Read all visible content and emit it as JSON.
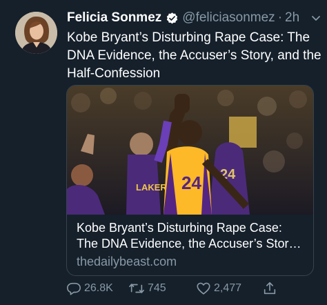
{
  "tweet": {
    "author_name": "Felicia Sonmez",
    "handle": "@feliciasonmez",
    "separator": "·",
    "time": "2h",
    "text": "Kobe Bryant’s Disturbing Rape Case: The DNA Evidence, the Accuser’s Story, and the Half-Confession"
  },
  "card": {
    "title": "Kobe Bryant’s Disturbing Rape Case: The DNA Evidence, the Accuser’s Story, and the Half-Confession",
    "domain": "thedailybeast.com",
    "jersey_numbers": [
      "24",
      "24"
    ],
    "jersey_text": "LAKERS"
  },
  "actions": {
    "replies": "26.8K",
    "retweets": "745",
    "likes": "2,477"
  },
  "colors": {
    "background": "#15202b",
    "secondary_text": "#8899a6",
    "border": "#38444d",
    "verified_badge": "#ffffff"
  },
  "icons": [
    "verified-icon",
    "chevron-down-icon",
    "reply-icon",
    "retweet-icon",
    "like-icon",
    "share-icon"
  ]
}
